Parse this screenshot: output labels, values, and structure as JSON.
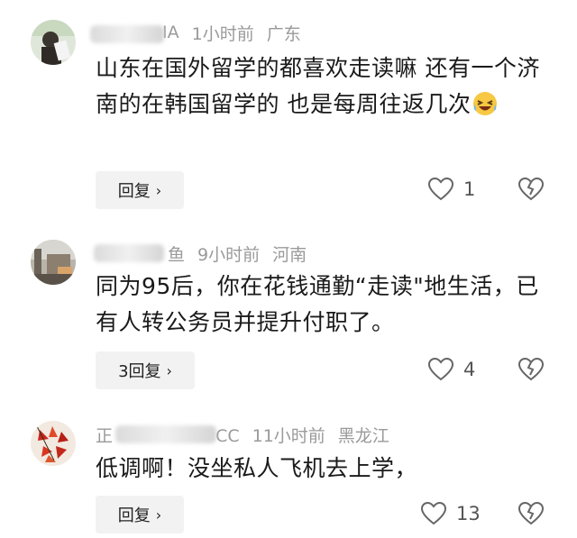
{
  "comments": [
    {
      "username_visible": "IA",
      "time": "1小时前",
      "location": "广东",
      "text": "山东在国外留学的都喜欢走读嘛 还有一个济南的在韩国留学的 也是每周往返几次",
      "emoji_icon": "grinning-squinting-face-emoji",
      "reply_label": "回复",
      "reply_chevron": "›",
      "like_count": "1"
    },
    {
      "username_visible": "鱼",
      "time": "9小时前",
      "location": "河南",
      "text": "同为95后，你在花钱通勤“走读\"地生活，已有人转公务员并提升付职了。",
      "reply_label": "3回复",
      "reply_chevron": "›",
      "like_count": "4"
    },
    {
      "username_visible": "正",
      "username_suffix": "CC",
      "time": "11小时前",
      "location": "黑龙江",
      "text": "低调啊！没坐私人飞机去上学，",
      "reply_label": "回复",
      "reply_chevron": "›",
      "like_count": "13"
    }
  ],
  "icons": {
    "like": "heart-outline-icon",
    "dislike": "broken-heart-outline-icon"
  }
}
